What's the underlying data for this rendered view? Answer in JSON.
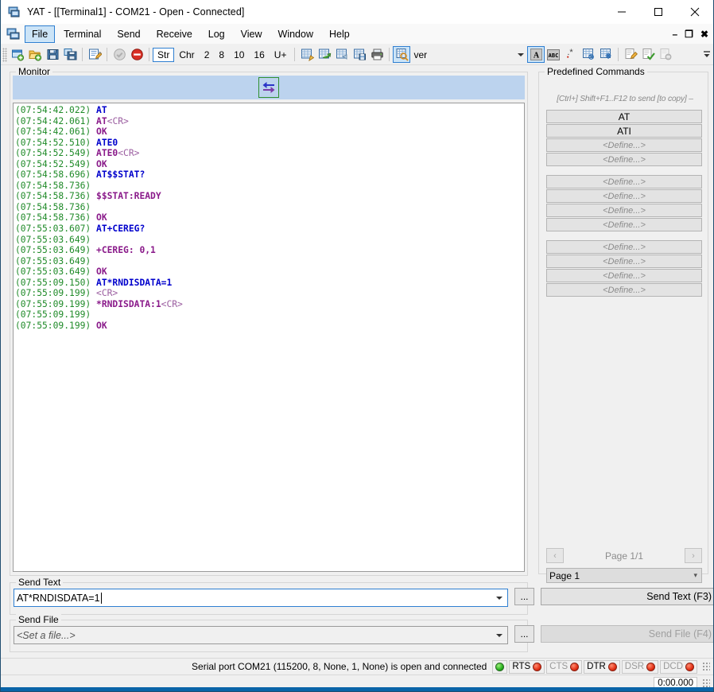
{
  "window": {
    "title": "YAT - [[Terminal1] - COM21 - Open - Connected]",
    "app_icon": "terminal-window-icon",
    "minimize": "minimize-icon",
    "maximize": "maximize-icon",
    "close": "close-icon"
  },
  "menubar": {
    "mdi_icon": "mdi-child-icon",
    "items": [
      {
        "label": "File",
        "active": true
      },
      {
        "label": "Terminal",
        "active": false
      },
      {
        "label": "Send",
        "active": false
      },
      {
        "label": "Receive",
        "active": false
      },
      {
        "label": "Log",
        "active": false
      },
      {
        "label": "View",
        "active": false
      },
      {
        "label": "Window",
        "active": false
      },
      {
        "label": "Help",
        "active": false
      }
    ],
    "mdi_minimize": "–",
    "mdi_restore": "❐",
    "mdi_close": "✖"
  },
  "toolbar": {
    "radix_labels": [
      "Str",
      "Chr",
      "2",
      "8",
      "10",
      "16",
      "U+"
    ],
    "radix_selected": "Str",
    "find_value": "ver",
    "find_placeholder": "",
    "icons": [
      "new-terminal-icon",
      "open-terminal-icon",
      "save-terminal-icon",
      "save-terminal-as-icon",
      "edit-terminal-settings-icon",
      "connect-icon",
      "disconnect-icon",
      "format-settings-icon",
      "clear-icon",
      "refresh-icon",
      "save-monitor-icon",
      "print-icon",
      "find-icon",
      "case-sensitive-icon",
      "whole-word-icon",
      "regex-icon",
      "find-next-icon",
      "find-all-icon",
      "edit-icon",
      "validate-icon",
      "remove-icon"
    ],
    "overflow": "toolbar-overflow-icon"
  },
  "monitor": {
    "legend": "Monitor",
    "direction_icon": "bidirectional-arrows-icon",
    "lines": [
      {
        "ts": "(07:54:42.022)",
        "text": "AT",
        "kind": "tx"
      },
      {
        "ts": "(07:54:42.061)",
        "text": "AT",
        "ctl": "<CR>",
        "kind": "rx"
      },
      {
        "ts": "(07:54:42.061)",
        "text": "OK",
        "kind": "rx"
      },
      {
        "ts": "(07:54:52.510)",
        "text": "ATE0",
        "kind": "tx"
      },
      {
        "ts": "(07:54:52.549)",
        "text": "ATE0",
        "ctl": "<CR>",
        "kind": "rx"
      },
      {
        "ts": "(07:54:52.549)",
        "text": "OK",
        "kind": "rx"
      },
      {
        "ts": "(07:54:58.696)",
        "text": "AT$$STAT?",
        "kind": "tx"
      },
      {
        "ts": "(07:54:58.736)",
        "text": "",
        "kind": "rx"
      },
      {
        "ts": "(07:54:58.736)",
        "text": "$$STAT:READY",
        "kind": "rx"
      },
      {
        "ts": "(07:54:58.736)",
        "text": "",
        "kind": "rx"
      },
      {
        "ts": "(07:54:58.736)",
        "text": "OK",
        "kind": "rx"
      },
      {
        "ts": "(07:55:03.607)",
        "text": "AT+CEREG?",
        "kind": "tx"
      },
      {
        "ts": "(07:55:03.649)",
        "text": "",
        "kind": "rx"
      },
      {
        "ts": "(07:55:03.649)",
        "text": "+CEREG: 0,1",
        "kind": "rx"
      },
      {
        "ts": "(07:55:03.649)",
        "text": "",
        "kind": "rx"
      },
      {
        "ts": "(07:55:03.649)",
        "text": "OK",
        "kind": "rx"
      },
      {
        "ts": "(07:55:09.150)",
        "text": "AT*RNDISDATA=1",
        "kind": "tx"
      },
      {
        "ts": "(07:55:09.199)",
        "text": "",
        "ctl": "<CR>",
        "kind": "rx"
      },
      {
        "ts": "(07:55:09.199)",
        "text": "*RNDISDATA:1",
        "ctl": "<CR>",
        "kind": "rx"
      },
      {
        "ts": "(07:55:09.199)",
        "text": "",
        "kind": "rx"
      },
      {
        "ts": "(07:55:09.199)",
        "text": "OK",
        "kind": "rx"
      }
    ]
  },
  "predefined": {
    "legend": "Predefined Commands",
    "hint": "[Ctrl+] Shift+F1..F12 to send [to copy] –",
    "buttons": [
      {
        "label": "AT",
        "defined": true
      },
      {
        "label": "ATI",
        "defined": true
      },
      {
        "label": "<Define...>",
        "defined": false
      },
      {
        "label": "<Define...>",
        "defined": false
      },
      {
        "label": "<Define...>",
        "defined": false
      },
      {
        "label": "<Define...>",
        "defined": false
      },
      {
        "label": "<Define...>",
        "defined": false
      },
      {
        "label": "<Define...>",
        "defined": false
      },
      {
        "label": "<Define...>",
        "defined": false
      },
      {
        "label": "<Define...>",
        "defined": false
      },
      {
        "label": "<Define...>",
        "defined": false
      },
      {
        "label": "<Define...>",
        "defined": false
      }
    ],
    "prev_icon": "‹",
    "next_icon": "›",
    "page_label": "Page 1/1",
    "page_select": "Page 1"
  },
  "send_text": {
    "legend": "Send Text",
    "value": "AT*RNDISDATA=1",
    "placeholder": "",
    "browse_label": "...",
    "button_label": "Send Text (F3)"
  },
  "send_file": {
    "legend": "Send File",
    "value": "<Set a file...>",
    "placeholder": "<Set a file...>",
    "browse_label": "...",
    "button_label": "Send File (F4)"
  },
  "status": {
    "message": "Serial port COM21 (115200, 8, None, 1, None) is open and connected",
    "connection_led": "green",
    "signals": [
      {
        "label": "RTS",
        "active": true,
        "led": "red"
      },
      {
        "label": "CTS",
        "active": false,
        "led": "red"
      },
      {
        "label": "DTR",
        "active": true,
        "led": "red"
      },
      {
        "label": "DSR",
        "active": false,
        "led": "red"
      },
      {
        "label": "DCD",
        "active": false,
        "led": "red"
      }
    ],
    "timer": "0:00.000"
  },
  "colors": {
    "tx": "#0000cc",
    "rx": "#8a1a8a",
    "timestamp": "#1f8a28",
    "control": "#9b5ea0",
    "accent": "#2f7fd1",
    "monitor_header": "#bcd3ee"
  }
}
